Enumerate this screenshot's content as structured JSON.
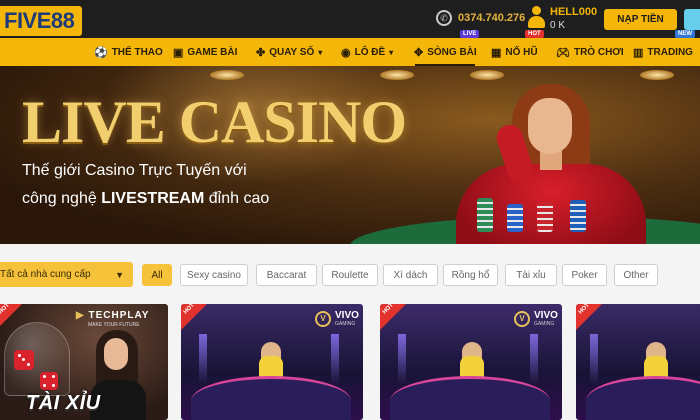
{
  "header": {
    "logo_text": "FIVE",
    "logo_number": "88",
    "phone": "0374.740.276",
    "username": "HELL000",
    "balance": "0 K",
    "deposit_label": "NẠP TIỀN"
  },
  "nav": {
    "items": [
      {
        "label": "THỂ THAO",
        "icon": "soccer-icon"
      },
      {
        "label": "GAME BÀI",
        "icon": "cards-icon"
      },
      {
        "label": "QUAY SỐ",
        "icon": "lottery-icon"
      },
      {
        "label": "LÔ ĐỀ",
        "icon": "ball-icon"
      },
      {
        "label": "SÒNG BÀI",
        "icon": "casino-icon",
        "badge": "LIVE"
      },
      {
        "label": "NỔ HŨ",
        "icon": "slot-icon",
        "badge": "HOT"
      },
      {
        "label": "TRÒ CHƠI",
        "icon": "gamepad-icon"
      },
      {
        "label": "TRADING",
        "icon": "chart-icon",
        "badge": "NEW"
      }
    ],
    "active": "SÒNG BÀI"
  },
  "banner": {
    "title": "LIVE CASINO",
    "line1": "Thế giới Casino Trực Tuyến với",
    "line2_prefix": "công nghệ ",
    "line2_bold": "LIVESTREAM",
    "line2_suffix": " đỉnh cao"
  },
  "filters": {
    "provider_label": "Tất cả nhà cung cấp",
    "categories": [
      "All",
      "Sexy casino",
      "Baccarat",
      "Roulette",
      "Xì dách",
      "Rồng hổ",
      "Tài xỉu",
      "Poker",
      "Other"
    ],
    "selected": "All"
  },
  "games": {
    "hot_label": "HOT",
    "card1": {
      "brand": "TECHPLAY",
      "brand_sub": "MAKE YOUR FUTURE",
      "title": "TÀI XỈU"
    },
    "card2": {
      "brand": "VIVO",
      "brand_sub": "GAMING"
    },
    "card3": {
      "brand": "VIVO",
      "brand_sub": "GAMING"
    }
  },
  "colors": {
    "accent": "#f5b60a",
    "header_bg": "#1e1e1e",
    "hot": "#e1322d",
    "live": "#5b3ad8"
  }
}
